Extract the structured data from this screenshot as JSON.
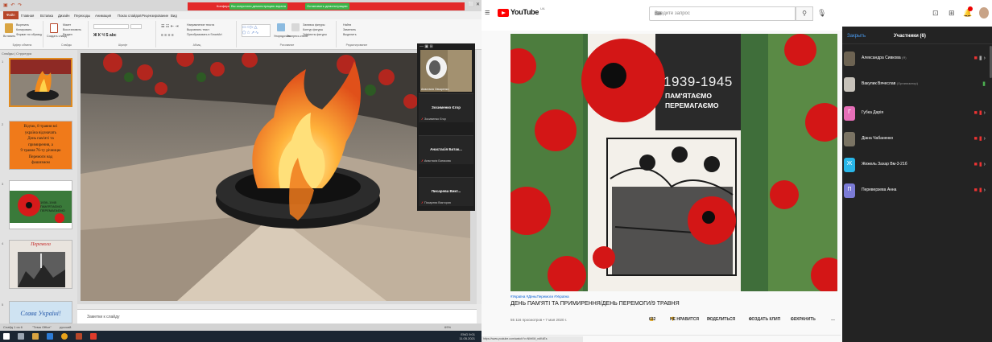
{
  "powerpoint": {
    "qat_icons": "▣ ↶ ↷",
    "share_banner": {
      "text": "Конференция Zoom",
      "pill_green": "Вы запустили демонстрацию экрана",
      "pill_red": "Остановить демонстрацию"
    },
    "window_buttons": "⬜ ✕",
    "menu": {
      "file": "Файл",
      "items": [
        "Главная",
        "Вставка",
        "Дизайн",
        "Переходы",
        "Анимация",
        "Показ слайдов",
        "Рецензирование",
        "Вид"
      ]
    },
    "ribbon": {
      "groups": [
        "Буфер обмена",
        "Слайды",
        "Шрифт",
        "Абзац",
        "Рисование",
        "Редактирование"
      ],
      "texts": {
        "paste": "Вставить",
        "cut": "Вырезать",
        "copy": "Копировать",
        "format": "Формат по образцу",
        "create_slide": "Создать слайд",
        "layout": "Макет",
        "reset": "Восстановить",
        "section": "Раздел",
        "text_dir": "Направление текста",
        "align_text": "Выровнять текст",
        "smartart": "Преобразовать в SmartArt",
        "arrange": "Упорядочить",
        "quick_styles": "Экспресс-стили",
        "shape_fill": "Заливка фигуры",
        "shape_outline": "Контур фигуры",
        "shape_effects": "Эффекты фигуры",
        "find": "Найти",
        "replace": "Заменить",
        "select": "Выделить"
      }
    },
    "thumb_tabs": "Слайды | Структура",
    "thumbs": [
      {
        "num": "1"
      },
      {
        "num": "2",
        "lines": [
          "Відтак, 8 травня всі",
          "україна відзначать",
          "День пам'яті та",
          "примирення, а",
          "9 травня 76-ту річницю",
          "Перемоги над",
          "фашизмом"
        ]
      },
      {
        "num": "3",
        "lines": [
          "1939–1945",
          "ПАМ'ЯТАЄМО",
          "ПЕРЕМАГАЄМО"
        ]
      },
      {
        "num": "4",
        "lines": [
          "Перемога"
        ]
      },
      {
        "num": "5",
        "lines": [
          "Слава Україні!"
        ]
      }
    ],
    "notes_placeholder": "Заметки к слайду",
    "status": {
      "slide": "Слайд 1 из 6",
      "theme": "\"Тема Office\"",
      "lang": "русский",
      "zoom": "69%"
    },
    "tray": {
      "time": "9:01",
      "date": "11.05.2021",
      "lang": "ENG"
    }
  },
  "zoom_panel": {
    "header_icons": "— ▣ ⊞",
    "video_caption": "Анастасія Овчаренко",
    "tiles": [
      {
        "name": "Зосименко Єгор",
        "sub": "Зосименко Єгор"
      },
      {
        "name": "Анастасія Батак...",
        "sub": "Анастасія Батакова"
      },
      {
        "name": "Писарева Викт...",
        "sub": "Писарева Виктория"
      }
    ]
  },
  "youtube": {
    "brand": "YouTube",
    "region": "UA",
    "search_placeholder": "Введите запрос",
    "video": {
      "hashtags": "#Україна #ДеньПеремоги #Україна",
      "title": "ДЕНЬ ПАМ'ЯТІ ТА ПРИМИРЕННЯ/ДЕНЬ ПЕРЕМОГИ/9 ТРАВНЯ",
      "stats": "55 116 просмотров • 7 мая 2020 г.",
      "likes": "632",
      "dislike": "НЕ НРАВИТСЯ",
      "share": "ПОДЕЛИТЬСЯ",
      "clip": "СОЗДАТЬ КЛИП",
      "save": "СОХРАНИТЬ",
      "poster_years": "1939-1945",
      "poster_line1": "ПАМ'ЯТАЄМО",
      "poster_line2": "ПЕРЕМАГАЄМО"
    },
    "url": "https://www.youtube.com/watch?v=NlhKM_ndKdEs"
  },
  "participants": {
    "close": "Закрыть",
    "title": "Участники (6)",
    "list": [
      {
        "name": "Александра Сивкова",
        "note": "(Я)",
        "color": "#6d6352",
        "initial": "",
        "mic": "grey"
      },
      {
        "name": "Вакулик Вячеслав",
        "note": "(Организатор)",
        "color": "#c7c2ba",
        "initial": "",
        "mic": "on"
      },
      {
        "name": "Губка Дарія",
        "note": "",
        "color": "#e66fb8",
        "initial": "Г",
        "mic": "off"
      },
      {
        "name": "Діана Чабаненко",
        "note": "",
        "color": "#7a7363",
        "initial": "",
        "mic": "off"
      },
      {
        "name": "Жежель Захар Вм-3-21б",
        "note": "",
        "color": "#29b6e8",
        "initial": "Ж",
        "mic": "off"
      },
      {
        "name": "Переверзева Анна",
        "note": "",
        "color": "#7b7bd6",
        "initial": "П",
        "mic": "off"
      }
    ]
  }
}
